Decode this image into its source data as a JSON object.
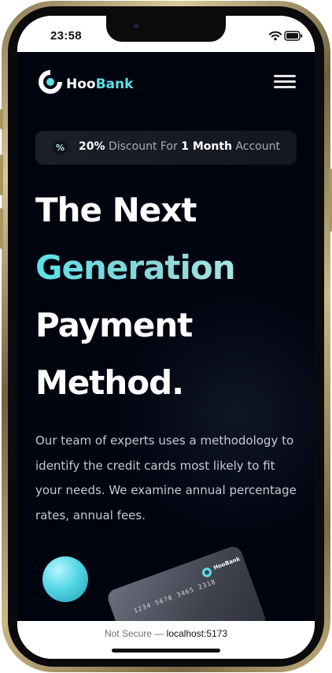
{
  "status_bar": {
    "time": "23:58",
    "icons": [
      "wifi-icon",
      "battery-icon"
    ]
  },
  "header": {
    "logo_hoo": "Hoo",
    "logo_bank": "Bank",
    "menu_icon": "hamburger-menu-icon"
  },
  "promo": {
    "icon": "percent-icon",
    "icon_glyph": "%",
    "discount_value": "20%",
    "text_1": " Discount For ",
    "duration": "1 Month",
    "text_2": " Account"
  },
  "hero": {
    "line_1": "The Next",
    "line_2": "Generation",
    "line_3": "Payment",
    "line_4": "Method.",
    "description": "Our team of experts uses a methodology to identify the credit cards most likely to fit your needs. We examine annual percentage rates, annual fees."
  },
  "card": {
    "number": "1234 5678 3465 2318",
    "brand": "HooBank"
  },
  "browser": {
    "security_label": "Not Secure —",
    "host": "localhost:5173"
  },
  "colors": {
    "accent": "#5ce1e6",
    "background": "#00040f",
    "frame_gold": "#cbb886"
  }
}
